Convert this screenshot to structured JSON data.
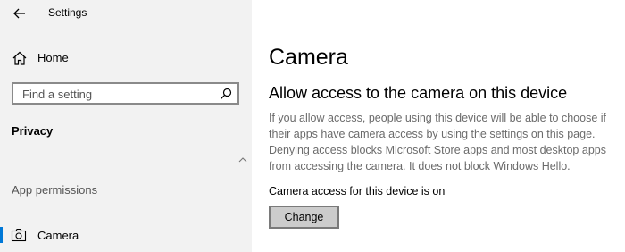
{
  "app": {
    "title": "Settings"
  },
  "sidebar": {
    "home_label": "Home",
    "search": {
      "placeholder": "Find a setting"
    },
    "section_privacy": "Privacy",
    "section_app_permissions": "App permissions",
    "items": [
      {
        "label": "Camera",
        "icon": "camera-icon",
        "selected": true
      }
    ]
  },
  "main": {
    "title": "Camera",
    "heading": "Allow access to the camera on this device",
    "description": "If you allow access, people using this device will be able to choose if their apps have camera access by using the settings on this page. Denying access blocks Microsoft Store apps and most desktop apps from accessing the camera. It does not block Windows Hello.",
    "status": "Camera access for this device is on",
    "change_button": "Change"
  },
  "colors": {
    "accent": "#0078d7",
    "sidebar_bg": "#f2f2f2",
    "button_bg": "#cccccc"
  }
}
